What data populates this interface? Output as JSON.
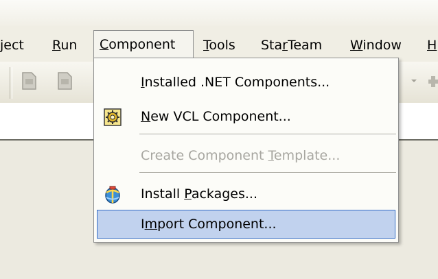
{
  "menubar": {
    "items": [
      {
        "label": "ject",
        "pre": "",
        "ul": "",
        "post": "ject"
      },
      {
        "label": "Run",
        "pre": "",
        "ul": "R",
        "post": "un"
      },
      {
        "label": "Component",
        "pre": "",
        "ul": "C",
        "post": "omponent"
      },
      {
        "label": "Tools",
        "pre": "",
        "ul": "T",
        "post": "ools"
      },
      {
        "label": "StarTeam",
        "pre": "Sta",
        "ul": "r",
        "post": "Team"
      },
      {
        "label": "Window",
        "pre": "",
        "ul": "W",
        "post": "indow"
      },
      {
        "label": "H",
        "pre": "",
        "ul": "H",
        "post": ""
      }
    ]
  },
  "dropdown": {
    "items": [
      {
        "label": "Installed .NET Components...",
        "pre": "",
        "ul": "I",
        "post": "nstalled .NET Components...",
        "icon": "",
        "enabled": true,
        "selected": false
      },
      {
        "label": "New VCL Component...",
        "pre": "",
        "ul": "N",
        "post": "ew VCL Component...",
        "icon": "gear-component-icon",
        "enabled": true,
        "selected": false
      },
      {
        "label": "Create Component Template...",
        "pre": "Create Component ",
        "ul": "T",
        "post": "emplate...",
        "icon": "",
        "enabled": false,
        "selected": false
      },
      {
        "label": "Install Packages...",
        "pre": "Install ",
        "ul": "P",
        "post": "ackages...",
        "icon": "package-icon",
        "enabled": true,
        "selected": false
      },
      {
        "label": "Import Component...",
        "pre": "I",
        "ul": "m",
        "post": "port Component...",
        "icon": "",
        "enabled": true,
        "selected": true
      }
    ]
  },
  "colors": {
    "selection_bg": "#c1d2ee",
    "selection_border": "#316ac5",
    "disabled_text": "#a7a6a0"
  }
}
